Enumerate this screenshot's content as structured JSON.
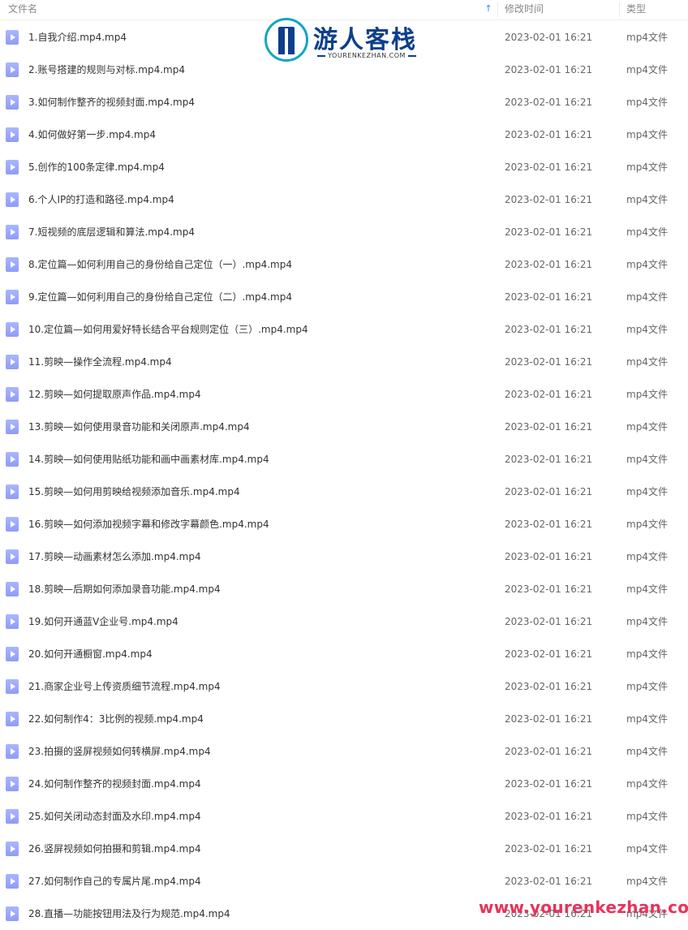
{
  "header": {
    "name_label": "文件名",
    "sort_indicator": "↑",
    "time_label": "修改时间",
    "type_label": "类型"
  },
  "files": [
    {
      "name": "1.自我介绍.mp4.mp4",
      "time": "2023-02-01 16:21",
      "type": "mp4文件"
    },
    {
      "name": "2.账号搭建的规则与对标.mp4.mp4",
      "time": "2023-02-01 16:21",
      "type": "mp4文件"
    },
    {
      "name": "3.如何制作整齐的视频封面.mp4.mp4",
      "time": "2023-02-01 16:21",
      "type": "mp4文件"
    },
    {
      "name": "4.如何做好第一步.mp4.mp4",
      "time": "2023-02-01 16:21",
      "type": "mp4文件"
    },
    {
      "name": "5.创作的100条定律.mp4.mp4",
      "time": "2023-02-01 16:21",
      "type": "mp4文件"
    },
    {
      "name": "6.个人IP的打造和路径.mp4.mp4",
      "time": "2023-02-01 16:21",
      "type": "mp4文件"
    },
    {
      "name": "7.短视频的底层逻辑和算法.mp4.mp4",
      "time": "2023-02-01 16:21",
      "type": "mp4文件"
    },
    {
      "name": "8.定位篇—如何利用自己的身份给自己定位（一）.mp4.mp4",
      "time": "2023-02-01 16:21",
      "type": "mp4文件"
    },
    {
      "name": "9.定位篇—如何利用自己的身份给自己定位（二）.mp4.mp4",
      "time": "2023-02-01 16:21",
      "type": "mp4文件"
    },
    {
      "name": "10.定位篇—如何用爱好特长结合平台规则定位（三）.mp4.mp4",
      "time": "2023-02-01 16:21",
      "type": "mp4文件"
    },
    {
      "name": "11.剪映—操作全流程.mp4.mp4",
      "time": "2023-02-01 16:21",
      "type": "mp4文件"
    },
    {
      "name": "12.剪映—如何提取原声作品.mp4.mp4",
      "time": "2023-02-01 16:21",
      "type": "mp4文件"
    },
    {
      "name": "13.剪映—如何使用录音功能和关闭原声.mp4.mp4",
      "time": "2023-02-01 16:21",
      "type": "mp4文件"
    },
    {
      "name": "14.剪映—如何使用贴纸功能和画中画素材库.mp4.mp4",
      "time": "2023-02-01 16:21",
      "type": "mp4文件"
    },
    {
      "name": "15.剪映—如何用剪映给视频添加音乐.mp4.mp4",
      "time": "2023-02-01 16:21",
      "type": "mp4文件"
    },
    {
      "name": "16.剪映—如何添加视频字幕和修改字幕颜色.mp4.mp4",
      "time": "2023-02-01 16:21",
      "type": "mp4文件"
    },
    {
      "name": "17.剪映—动画素材怎么添加.mp4.mp4",
      "time": "2023-02-01 16:21",
      "type": "mp4文件"
    },
    {
      "name": "18.剪映—后期如何添加录音功能.mp4.mp4",
      "time": "2023-02-01 16:21",
      "type": "mp4文件"
    },
    {
      "name": "19.如何开通蓝V企业号.mp4.mp4",
      "time": "2023-02-01 16:21",
      "type": "mp4文件"
    },
    {
      "name": "20.如何开通橱窗.mp4.mp4",
      "time": "2023-02-01 16:21",
      "type": "mp4文件"
    },
    {
      "name": "21.商家企业号上传资质细节流程.mp4.mp4",
      "time": "2023-02-01 16:21",
      "type": "mp4文件"
    },
    {
      "name": "22.如何制作4：3比例的视频.mp4.mp4",
      "time": "2023-02-01 16:21",
      "type": "mp4文件"
    },
    {
      "name": "23.拍摄的竖屏视频如何转横屏.mp4.mp4",
      "time": "2023-02-01 16:21",
      "type": "mp4文件"
    },
    {
      "name": "24.如何制作整齐的视频封面.mp4.mp4",
      "time": "2023-02-01 16:21",
      "type": "mp4文件"
    },
    {
      "name": "25.如何关闭动态封面及水印.mp4.mp4",
      "time": "2023-02-01 16:21",
      "type": "mp4文件"
    },
    {
      "name": "26.竖屏视频如何拍摄和剪辑.mp4.mp4",
      "time": "2023-02-01 16:21",
      "type": "mp4文件"
    },
    {
      "name": "27.如何制作自己的专属片尾.mp4.mp4",
      "time": "2023-02-01 16:21",
      "type": "mp4文件"
    },
    {
      "name": "28.直播—功能按钮用法及行为规范.mp4.mp4",
      "time": "2023-02-01 16:21",
      "type": "mp4文件"
    }
  ],
  "watermark": {
    "logo_title": "游人客栈",
    "logo_subtitle": "YOURENKEZHAN.COM",
    "url": "www.yourenkezhan.com"
  },
  "colors": {
    "icon": "#9aa6f9",
    "sort_arrow": "#2f8be6",
    "logo_blue": "#0d3f8c",
    "watermark_red": "#e8335a"
  }
}
